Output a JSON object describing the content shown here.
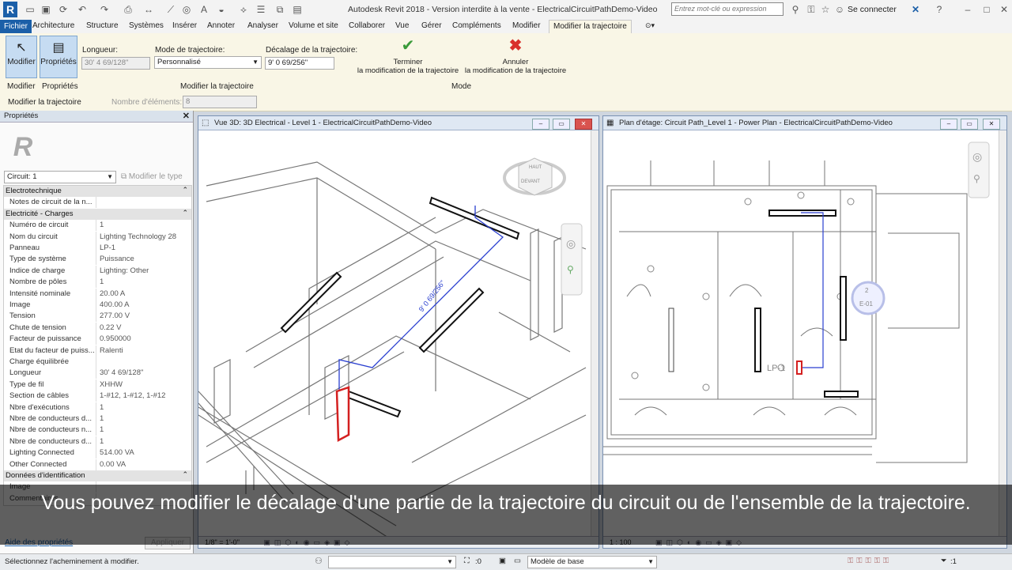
{
  "titlebar": {
    "app_title": "Autodesk Revit 2018 - Version interdite à la vente -   ElectricalCircuitPathDemo-Video",
    "search_placeholder": "Entrez mot-clé ou expression",
    "sign_in": "Se connecter"
  },
  "tabs": [
    "Fichier",
    "Architecture",
    "Structure",
    "Systèmes",
    "Insérer",
    "Annoter",
    "Analyser",
    "Volume et site",
    "Collaborer",
    "Vue",
    "Gérer",
    "Compléments",
    "Modifier",
    "Modifier la trajectoire"
  ],
  "ribbon": {
    "modify_label": "Modifier",
    "properties_label": "Propriétés",
    "length_label": "Longueur:",
    "length_value": "30'  4 69/128\"",
    "mode_label": "Mode de trajectoire:",
    "mode_value": "Personnalisé",
    "offset_label": "Décalage de la trajectoire:",
    "offset_value": "9'  0 69/256\"",
    "finish_line1": "Terminer",
    "finish_line2": "la modification de la trajectoire",
    "cancel_line1": "Annuler",
    "cancel_line2": "la modification de la trajectoire",
    "panel_modify": "Modifier",
    "panel_properties": "Propriétés",
    "panel_path": "Modifier la trajectoire",
    "panel_mode": "Mode",
    "context_label": "Modifier la trajectoire",
    "count_label": "Nombre d'éléments:",
    "count_value": "8"
  },
  "properties": {
    "title": "Propriétés",
    "selector": "Circuit: 1",
    "edit_type": "Modifier le type",
    "rows": [
      {
        "k": "Electrotechnique",
        "sec": true
      },
      {
        "k": "Notes de circuit de la n...",
        "v": ""
      },
      {
        "k": "Electricité - Charges",
        "sec": true
      },
      {
        "k": "Numéro de circuit",
        "v": "1"
      },
      {
        "k": "Nom du circuit",
        "v": "Lighting Technology 28"
      },
      {
        "k": "Panneau",
        "v": "LP-1"
      },
      {
        "k": "Type de système",
        "v": "Puissance"
      },
      {
        "k": "Indice de charge",
        "v": "Lighting: Other"
      },
      {
        "k": "Nombre de pôles",
        "v": "1"
      },
      {
        "k": "Intensité nominale",
        "v": "20.00 A"
      },
      {
        "k": "Image",
        "v": "400.00 A"
      },
      {
        "k": "Tension",
        "v": "277.00 V"
      },
      {
        "k": "Chute de tension",
        "v": "0.22 V"
      },
      {
        "k": "Facteur de puissance",
        "v": "0.950000"
      },
      {
        "k": "Etat du facteur de puiss...",
        "v": "Ralenti"
      },
      {
        "k": "Charge équilibrée",
        "v": ""
      },
      {
        "k": "Longueur",
        "v": "30'  4 69/128\""
      },
      {
        "k": "Type de fil",
        "v": "XHHW"
      },
      {
        "k": "Section de câbles",
        "v": "1-#12, 1-#12, 1-#12"
      },
      {
        "k": "Nbre d'exécutions",
        "v": "1"
      },
      {
        "k": "Nbre de conducteurs d...",
        "v": "1"
      },
      {
        "k": "Nbre de conducteurs n...",
        "v": "1"
      },
      {
        "k": "Nbre de conducteurs d...",
        "v": "1"
      },
      {
        "k": "Lighting Connected",
        "v": "514.00 VA"
      },
      {
        "k": "Other Connected",
        "v": "0.00 VA"
      },
      {
        "k": "Données d'identification",
        "sec": true
      },
      {
        "k": "Image",
        "v": ""
      },
      {
        "k": "Commentaires",
        "v": ""
      }
    ],
    "help_link": "Aide des propriétés",
    "apply": "Appliquer"
  },
  "view3d": {
    "title": "Vue 3D: 3D Electrical - Level 1 - ElectricalCircuitPathDemo-Video",
    "scale": "1/8\" = 1'-0\"",
    "dim_label": "9'  0 69/256\"",
    "cube_top": "HAUT",
    "cube_side": "DEVANT"
  },
  "viewplan": {
    "title": "Plan d'étage: Circuit Path_Level 1 - Power Plan - ElectricalCircuitPathDemo-Video",
    "scale": "1 : 100",
    "panel_tag": "LP-1",
    "tag_number": "2",
    "tag_text": "E-01"
  },
  "subtitle": "Vous pouvez modifier le décalage d'une partie de la trajectoire du circuit ou de l'ensemble de la trajectoire.",
  "status": {
    "message": "Sélectionnez l'acheminement à modifier.",
    "count": ":0",
    "base_model": "Modèle de base",
    "filter_count": ":1"
  }
}
